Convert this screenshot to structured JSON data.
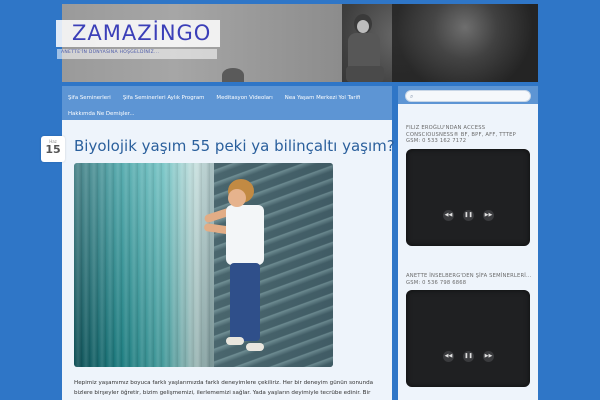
{
  "header": {
    "site_title": "ZAMAZİNGO",
    "tagline": "ANETTE'İN DÜNYASINA HOŞGELDİNİZ..."
  },
  "nav": {
    "items": [
      "Şifa Seminerleri",
      "Şifa Seminerleri Aylık Program",
      "Meditasyon Videoları",
      "Nea Yaşam Merkezi Yol Tarifi",
      "Hakkımda Ne Demişler..."
    ]
  },
  "post": {
    "date_month": "Haz",
    "date_day": "15",
    "title": "Biyolojik yaşım 55 peki ya bilinçaltı yaşım?",
    "excerpt": "Hepimiz yaşamımız boyuca farklı yaşlarımızda farklı deneyimlere çekiliriz. Her bir deneyim günün sonunda bizlere birşeyler öğretir, bizim gelişmemizi, ilerlememizi sağlar. Yada yaşların deyimiyle tecrübe edinir. Bir"
  },
  "sidebar": {
    "search_icon": "search-icon",
    "widget1_title": "FILIZ EROĞLU'NDAN ACCESS CONSCIOUSNESS® BF, BPF, AFF, TTTEP GSM: 0 533 162 7172",
    "widget2_title": "ANETTE İNSELBERG'DEN ŞİFA SEMİNERLERİ... GSM: 0 536 798 6868",
    "video_controls": [
      "◀◀",
      "❚❚",
      "▶▶"
    ]
  },
  "colors": {
    "background": "#2f76c7",
    "nav": "#5d95d4",
    "content": "#eef4fb",
    "title": "#2a5f9c"
  }
}
